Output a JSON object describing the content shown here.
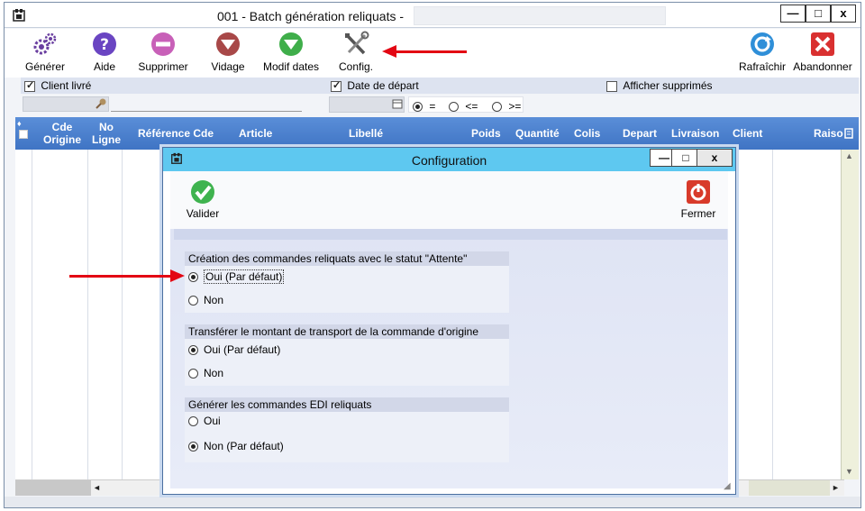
{
  "window": {
    "title": "001 -  Batch génération reliquats -",
    "minimize": "—",
    "maximize": "□",
    "close": "x"
  },
  "toolbar": {
    "generer": "Générer",
    "aide": "Aide",
    "supprimer": "Supprimer",
    "vidage": "Vidage",
    "modif_dates": "Modif dates",
    "config": "Config.",
    "rafraichir": "Rafraîchir",
    "abandonner": "Abandonner"
  },
  "filters": {
    "client_livre": "Client livré",
    "date_depart": "Date de départ",
    "afficher_supprimes": "Afficher supprimés",
    "op_eq": "=",
    "op_le": "<=",
    "op_ge": ">="
  },
  "grid": {
    "columns": {
      "cde_origine": "Cde Origine",
      "no_ligne": "No Ligne",
      "reference_cde": "Référence Cde",
      "article": "Article",
      "libelle": "Libellé",
      "poids": "Poids",
      "quantite": "Quantité",
      "colis": "Colis",
      "depart": "Depart",
      "livraison": "Livraison",
      "client": "Client",
      "raison": "Raiso"
    }
  },
  "dialog": {
    "title": "Configuration",
    "valider": "Valider",
    "fermer": "Fermer",
    "sections": [
      {
        "title": "Création des commandes reliquats avec le statut \"Attente\"",
        "opt1": "Oui (Par défaut)",
        "opt2": "Non"
      },
      {
        "title": "Transférer le montant de transport de la commande d'origine",
        "opt1": "Oui (Par défaut)",
        "opt2": "Non"
      },
      {
        "title": "Générer les commandes EDI reliquats",
        "opt1": "Oui",
        "opt2": "Non (Par défaut)"
      }
    ]
  },
  "colors": {
    "header_blue": "#3f74c4",
    "dialog_title": "#5ec8f0",
    "annotation_red": "#e30613"
  }
}
